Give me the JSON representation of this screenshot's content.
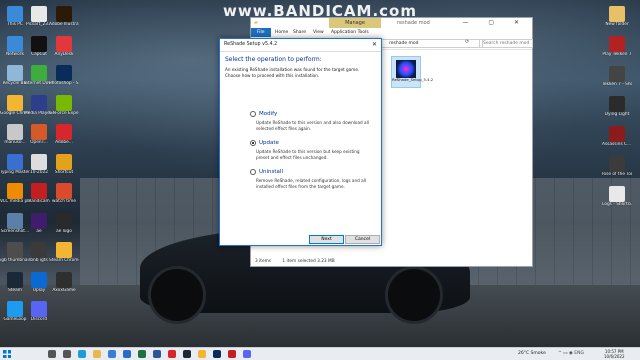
{
  "watermark": {
    "text": "www.BANDICAM.com"
  },
  "desktop": {
    "left_icons": [
      {
        "label": "This PC",
        "color": "#3b8ad8"
      },
      {
        "label": "Picsart_23...",
        "color": "#e8e8e8"
      },
      {
        "label": "Adobe Illustrator",
        "color": "#2b1a05"
      },
      {
        "label": "Network",
        "color": "#3b8ad8"
      },
      {
        "label": "CapCut",
        "color": "#111111"
      },
      {
        "label": "AnyDesk",
        "color": "#e2383d"
      },
      {
        "label": "Recycle Bin",
        "color": "#8fb7d8"
      },
      {
        "label": "Internet Downlo...",
        "color": "#3dae3d"
      },
      {
        "label": "Photoshop - Shortcut",
        "color": "#0a2c5a"
      },
      {
        "label": "Google Chrome",
        "color": "#f2b632"
      },
      {
        "label": "Media Player Classic",
        "color": "#2d3f8a"
      },
      {
        "label": "GeForce Experience",
        "color": "#76b900"
      },
      {
        "label": "manuso...",
        "color": "#c8c8c8"
      },
      {
        "label": "OpenT...",
        "color": "#d45a2a"
      },
      {
        "label": "Adobe...",
        "color": "#d8262d"
      },
      {
        "label": "Typing Master 11",
        "color": "#3a6fd0"
      },
      {
        "label": "10-2022",
        "color": "#dddddd"
      },
      {
        "label": "Shortcut",
        "color": "#e4a11b"
      },
      {
        "label": "VLC media player",
        "color": "#f08a00"
      },
      {
        "label": "Bandicam",
        "color": "#c51e1e"
      },
      {
        "label": "watch time",
        "color": "#d94b2b"
      },
      {
        "label": "Screenshot...",
        "color": "#5b7fa6"
      },
      {
        "label": "ae",
        "color": "#3f1d6b"
      },
      {
        "label": "ae logo",
        "color": "#2a2a2a"
      },
      {
        "label": "igb thumbnail",
        "color": "#4d4d4d"
      },
      {
        "label": "bnb igts",
        "color": "#3a3a3a"
      },
      {
        "label": "Steam Chrome",
        "color": "#f2b632"
      },
      {
        "label": "Steam",
        "color": "#1b2838"
      },
      {
        "label": "Uplay",
        "color": "#0a6ad1"
      },
      {
        "label": "AxxxGame",
        "color": "#2f2f2f"
      },
      {
        "label": "GameLoop",
        "color": "#1d9bf0"
      },
      {
        "label": "Discord",
        "color": "#5865f2"
      }
    ],
    "right_icons": [
      {
        "label": "New folder",
        "color": "#e8c067"
      },
      {
        "label": "Play Tekken 7",
        "color": "#b22222"
      },
      {
        "label": "Tekken 7 - Shortcut",
        "color": "#444444"
      },
      {
        "label": "Dying Light",
        "color": "#2b2b2b"
      },
      {
        "label": "Assassins C... - Shortcut",
        "color": "#8a1c1c"
      },
      {
        "label": "Rise of the Tomb Raider",
        "color": "#3b3b3b"
      },
      {
        "label": "Logs - Shortcut",
        "color": "#e8e8e8"
      }
    ]
  },
  "explorer": {
    "manage_tab": "Manage",
    "title": "reshade mod",
    "window_buttons": "— ▢ ✕",
    "tabs": {
      "file": "File",
      "home": "Home",
      "share": "Share",
      "view": "View",
      "app_tools": "Application Tools"
    },
    "address_path": "reshade mod",
    "search_placeholder": "Search reshade mod",
    "selected_file": "ReShade_Setup_5.4.2",
    "status": {
      "items": "3 items",
      "selection": "1 item selected  3.23 MB"
    }
  },
  "dialog": {
    "title": "ReShade Setup v5.4.2",
    "close": "✕",
    "heading": "Select the operation to perform:",
    "description": "An existing ReShade installation was found for the target game. Choose how to proceed with this installation.",
    "options": [
      {
        "label": "Modify",
        "desc": "Update ReShade to this version and also download all selected effect files again.",
        "selected": false
      },
      {
        "label": "Update",
        "desc": "Update ReShade to this version but keep existing preset and effect files unchanged.",
        "selected": true
      },
      {
        "label": "Uninstall",
        "desc": "Remove ReShade, related configuration, logs and all installed effect files from the target game.",
        "selected": false
      }
    ],
    "next_label": "Next",
    "cancel_label": "Cancel"
  },
  "taskbar": {
    "icons": [
      {
        "name": "search-icon",
        "color": "#555555"
      },
      {
        "name": "task-view-icon",
        "color": "#555555"
      },
      {
        "name": "edge-icon",
        "color": "#1f9bd6"
      },
      {
        "name": "explorer-icon",
        "color": "#e8b84a"
      },
      {
        "name": "store-icon",
        "color": "#3b7fd4"
      },
      {
        "name": "mail-icon",
        "color": "#2a6bc4"
      },
      {
        "name": "excel-icon",
        "color": "#1e7145"
      },
      {
        "name": "word-icon",
        "color": "#2b5797"
      },
      {
        "name": "adobe-icon",
        "color": "#d8262d"
      },
      {
        "name": "steam-icon",
        "color": "#1b2838"
      },
      {
        "name": "chrome-icon",
        "color": "#f2b632"
      },
      {
        "name": "photoshop-icon",
        "color": "#0a2c5a"
      },
      {
        "name": "bandicam-icon",
        "color": "#c51e1e"
      },
      {
        "name": "discord-icon",
        "color": "#5865f2"
      }
    ],
    "weather": "26°C  Smoke",
    "tray": "^  ▭  ◉  ENG",
    "time": "10:57 PM",
    "date": "10/6/2022"
  }
}
